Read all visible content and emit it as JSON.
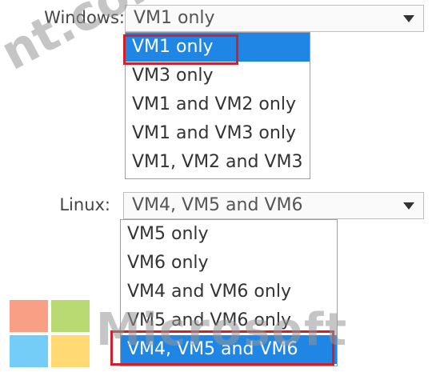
{
  "windows": {
    "label": "Windows:",
    "selected_value": "VM1 only",
    "options": [
      "VM1 only",
      "VM3 only",
      "VM1 and VM2 only",
      "VM1 and VM3 only",
      "VM1, VM2 and VM3"
    ],
    "highlighted_option": "VM1 only"
  },
  "linux": {
    "label": "Linux:",
    "selected_value": "VM4, VM5 and VM6",
    "options": [
      "VM5 only",
      "VM6 only",
      "VM4 and VM6 only",
      "VM5 and VM6 only",
      "VM4, VM5 and VM6"
    ],
    "highlighted_option": "VM4, VM5 and VM6"
  },
  "watermark": {
    "top_text": "nt.com",
    "bottom_text": "Microsoft"
  },
  "colors": {
    "selection": "#1f86e6",
    "answer_box": "#d0202a",
    "logo": [
      "#f25022",
      "#7fba00",
      "#00a4ef",
      "#ffb900"
    ]
  },
  "icons": {
    "dropdown_arrow": "triangle-down-icon",
    "logo": "microsoft-logo-icon"
  }
}
